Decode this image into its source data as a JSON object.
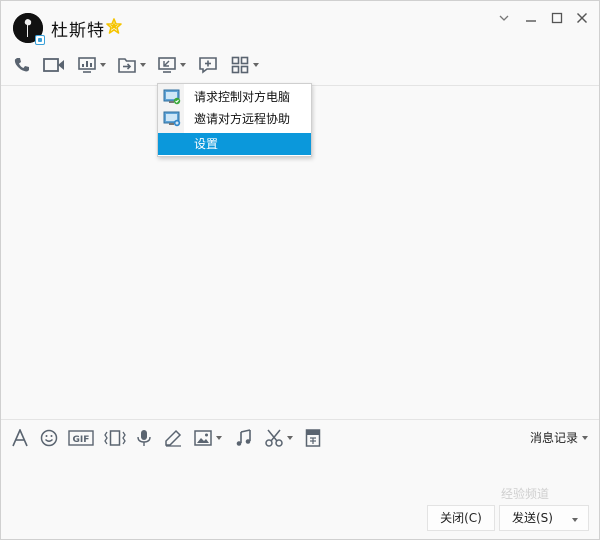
{
  "titlebar": {
    "contact_name": "杜斯特",
    "window_controls": [
      "chevron-down-icon",
      "minimize-icon",
      "maximize-icon",
      "close-icon"
    ]
  },
  "toolbar": {
    "icons": [
      "phone-icon",
      "video-call-icon",
      "screen-share-icon",
      "file-transfer-icon",
      "remote-desktop-icon",
      "add-comment-icon",
      "apps-grid-icon"
    ]
  },
  "remote_menu": {
    "items": [
      {
        "label": "请求控制对方电脑",
        "icon": "monitor-request-icon"
      },
      {
        "label": "邀请对方远程协助",
        "icon": "monitor-invite-icon"
      },
      {
        "label": "设置",
        "selected": true
      }
    ]
  },
  "input_toolbar": {
    "icons": [
      "font-icon",
      "emoji-icon",
      "gif-icon",
      "shake-window-icon",
      "voice-message-icon",
      "handwrite-icon",
      "image-icon",
      "music-icon",
      "screenshot-scissors-icon",
      "red-packet-icon"
    ],
    "history_label": "消息记录"
  },
  "footer": {
    "close_label": "关闭(C)",
    "send_label": "发送(S)"
  },
  "watermark": "经验频道",
  "colors": {
    "accent": "#0b98db",
    "star": "#f5c400",
    "icon": "#5a6470"
  }
}
